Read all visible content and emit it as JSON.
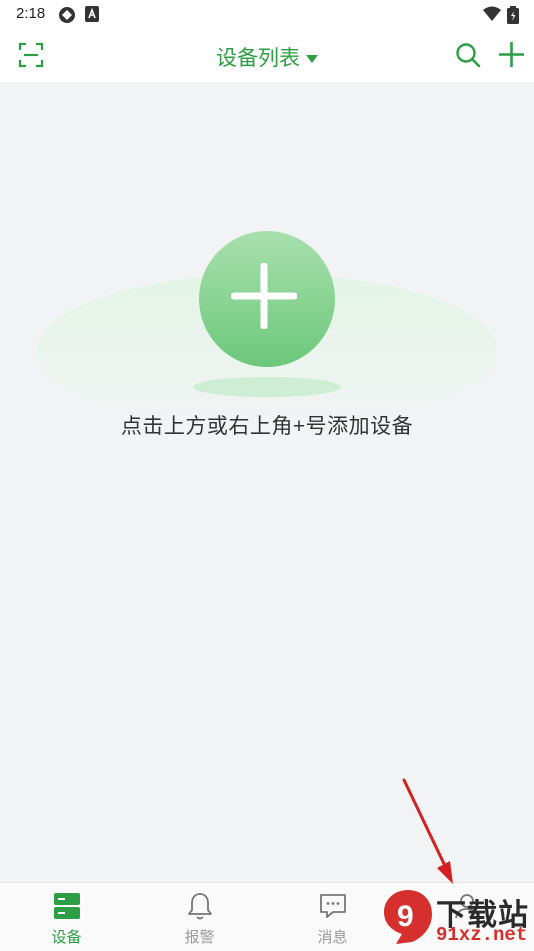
{
  "status_bar": {
    "time": "2:18"
  },
  "top_bar": {
    "title": "设备列表",
    "icons": [
      "scan-icon",
      "search-icon",
      "add-icon"
    ]
  },
  "main": {
    "empty_hint": "点击上方或右上角+号添加设备"
  },
  "tab_bar": {
    "tabs": [
      {
        "label": "设备",
        "icon": "device-icon",
        "active": true
      },
      {
        "label": "报警",
        "icon": "bell-icon",
        "active": false
      },
      {
        "label": "消息",
        "icon": "message-icon",
        "active": false
      },
      {
        "label": "",
        "icon": "user-icon",
        "active": false
      }
    ]
  },
  "watermark": {
    "badge": "9",
    "line1": "下载站",
    "line2": "91xz.net"
  },
  "colors": {
    "accent": "#2e9e45",
    "background": "#f2f3f5",
    "annotation_arrow": "#d42020"
  }
}
